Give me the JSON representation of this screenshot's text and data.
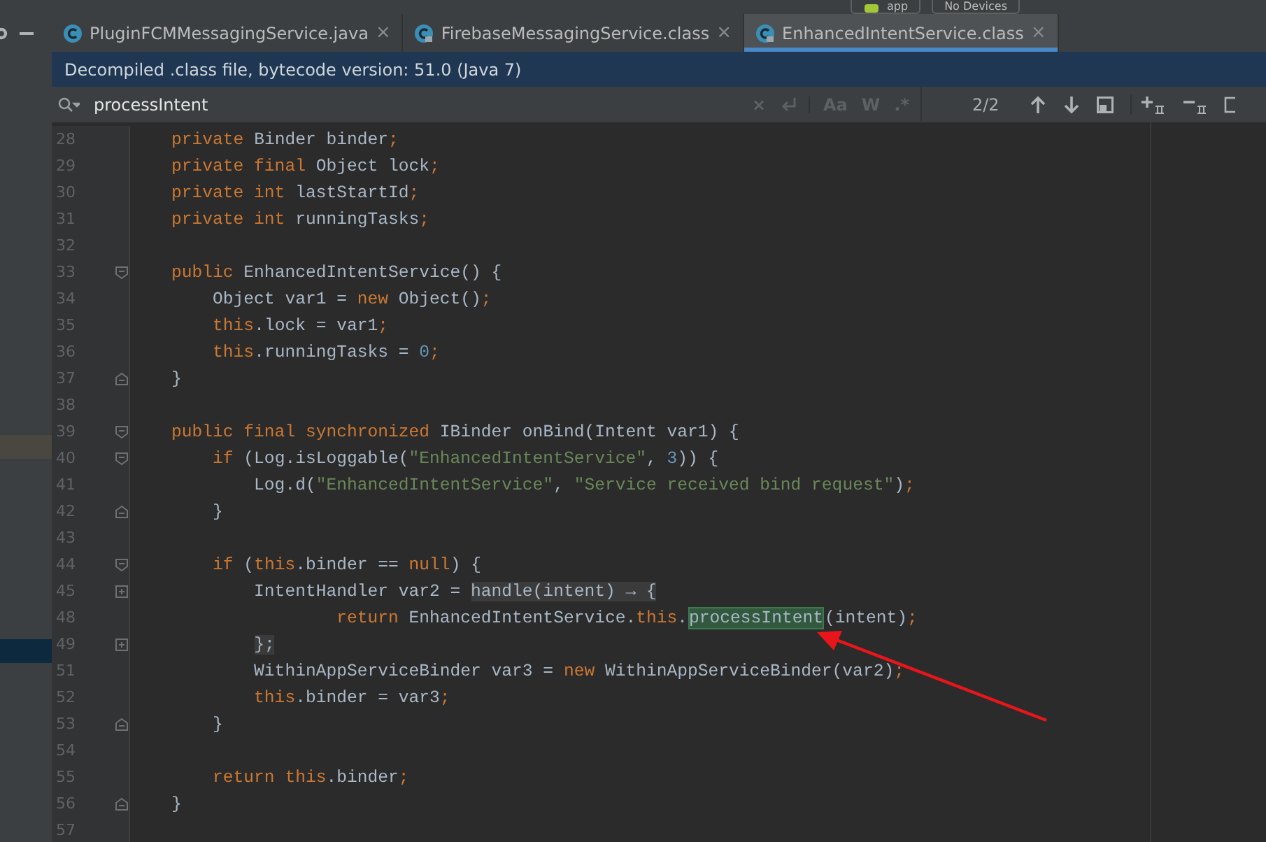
{
  "toolbar": {
    "configuration": "app",
    "device": "No Devices"
  },
  "tabs": [
    {
      "label": "PluginFCMMessagingService.java",
      "locked": false,
      "selected": false,
      "close": "×"
    },
    {
      "label": "FirebaseMessagingService.class",
      "locked": true,
      "selected": false,
      "close": "×"
    },
    {
      "label": "EnhancedIntentService.class",
      "locked": true,
      "selected": true,
      "close": "×"
    }
  ],
  "banner": "Decompiled .class file, bytecode version: 51.0 (Java 7)",
  "search": {
    "value": "processIntent",
    "clear": "×",
    "options": [
      "Aa",
      "W",
      ".*"
    ],
    "count": "2/2"
  },
  "lines": [
    {
      "number": "28",
      "tokens": [
        {
          "kind": "kw",
          "text": "    private"
        },
        {
          "kind": "plain",
          "text": " Binder binder"
        },
        {
          "kind": "kw",
          "text": ";"
        }
      ]
    },
    {
      "number": "29",
      "tokens": [
        {
          "kind": "kw",
          "text": "    private final"
        },
        {
          "kind": "plain",
          "text": " Object lock"
        },
        {
          "kind": "kw",
          "text": ";"
        }
      ]
    },
    {
      "number": "30",
      "tokens": [
        {
          "kind": "kw",
          "text": "    private int"
        },
        {
          "kind": "plain",
          "text": " lastStartId"
        },
        {
          "kind": "kw",
          "text": ";"
        }
      ]
    },
    {
      "number": "31",
      "tokens": [
        {
          "kind": "kw",
          "text": "    private int"
        },
        {
          "kind": "plain",
          "text": " runningTasks"
        },
        {
          "kind": "kw",
          "text": ";"
        }
      ]
    },
    {
      "number": "32"
    },
    {
      "number": "33",
      "kind": "foldstart",
      "tokens": [
        {
          "kind": "kw",
          "text": "    public"
        },
        {
          "kind": "plain",
          "text": " EnhancedIntentService() {"
        }
      ]
    },
    {
      "number": "34",
      "tokens": [
        {
          "kind": "plain",
          "text": "        Object var1 = "
        },
        {
          "kind": "kw",
          "text": "new"
        },
        {
          "kind": "plain",
          "text": " Object()"
        },
        {
          "kind": "kw",
          "text": ";"
        }
      ]
    },
    {
      "number": "35",
      "tokens": [
        {
          "kind": "kw",
          "text": "        this"
        },
        {
          "kind": "plain",
          "text": ".lock = var1"
        },
        {
          "kind": "kw",
          "text": ";"
        }
      ]
    },
    {
      "number": "36",
      "tokens": [
        {
          "kind": "kw",
          "text": "        this"
        },
        {
          "kind": "plain",
          "text": ".runningTasks = "
        },
        {
          "kind": "num",
          "text": "0"
        },
        {
          "kind": "kw",
          "text": ";"
        }
      ]
    },
    {
      "number": "37",
      "kind": "foldend",
      "tokens": [
        {
          "kind": "plain",
          "text": "    }"
        }
      ]
    },
    {
      "number": "38"
    },
    {
      "number": "39",
      "kind": "foldstart",
      "tokens": [
        {
          "kind": "kw",
          "text": "    public final synchronized"
        },
        {
          "kind": "plain",
          "text": " IBinder onBind(Intent var1) {"
        }
      ]
    },
    {
      "number": "40",
      "kind": "foldstart",
      "tokens": [
        {
          "kind": "kw",
          "text": "        if"
        },
        {
          "kind": "plain",
          "text": " (Log.isLoggable("
        },
        {
          "kind": "str",
          "text": "\"EnhancedIntentService\""
        },
        {
          "kind": "plain",
          "text": ", "
        },
        {
          "kind": "num",
          "text": "3"
        },
        {
          "kind": "plain",
          "text": ")) {"
        }
      ]
    },
    {
      "number": "41",
      "tokens": [
        {
          "kind": "plain",
          "text": "            Log.d("
        },
        {
          "kind": "str",
          "text": "\"EnhancedIntentService\""
        },
        {
          "kind": "plain",
          "text": ", "
        },
        {
          "kind": "str",
          "text": "\"Service received bind request\""
        },
        {
          "kind": "plain",
          "text": ")"
        },
        {
          "kind": "kw",
          "text": ";"
        }
      ]
    },
    {
      "number": "42",
      "kind": "foldend",
      "tokens": [
        {
          "kind": "plain",
          "text": "        }"
        }
      ]
    },
    {
      "number": "43"
    },
    {
      "number": "44",
      "kind": "foldstart",
      "tokens": [
        {
          "kind": "kw",
          "text": "        if"
        },
        {
          "kind": "plain",
          "text": " ("
        },
        {
          "kind": "kw",
          "text": "this"
        },
        {
          "kind": "plain",
          "text": ".binder == "
        },
        {
          "kind": "kw",
          "text": "null"
        },
        {
          "kind": "plain",
          "text": ") {"
        }
      ]
    },
    {
      "number": "45",
      "kind": "collapsed",
      "tokens": [
        {
          "kind": "plain",
          "text": "            IntentHandler var2 = "
        },
        {
          "kind": "folded",
          "text": "handle(intent) → {"
        }
      ]
    },
    {
      "number": "48",
      "tokens": [
        {
          "kind": "kw",
          "text": "                    return"
        },
        {
          "kind": "plain",
          "text": " EnhancedIntentService."
        },
        {
          "kind": "kw",
          "text": "this"
        },
        {
          "kind": "plain",
          "text": "."
        },
        {
          "kind": "match",
          "text": "processIntent"
        },
        {
          "kind": "plain",
          "text": "(intent)"
        },
        {
          "kind": "kw",
          "text": ";"
        }
      ]
    },
    {
      "number": "49",
      "kind": "collapsed",
      "tokens": [
        {
          "kind": "folded",
          "text": "            };"
        }
      ]
    },
    {
      "number": "51",
      "tokens": [
        {
          "kind": "plain",
          "text": "            WithinAppServiceBinder var3 = "
        },
        {
          "kind": "kw",
          "text": "new"
        },
        {
          "kind": "plain",
          "text": " WithinAppServiceBinder(var2)"
        },
        {
          "kind": "kw",
          "text": ";"
        }
      ]
    },
    {
      "number": "52",
      "tokens": [
        {
          "kind": "kw",
          "text": "            this"
        },
        {
          "kind": "plain",
          "text": ".binder = var3"
        },
        {
          "kind": "kw",
          "text": ";"
        }
      ]
    },
    {
      "number": "53",
      "kind": "foldend",
      "tokens": [
        {
          "kind": "plain",
          "text": "        }"
        }
      ]
    },
    {
      "number": "54"
    },
    {
      "number": "55",
      "tokens": [
        {
          "kind": "kw",
          "text": "        return this"
        },
        {
          "kind": "plain",
          "text": ".binder"
        },
        {
          "kind": "kw",
          "text": ";"
        }
      ]
    },
    {
      "number": "56",
      "kind": "foldend",
      "tokens": [
        {
          "kind": "plain",
          "text": "    }"
        }
      ]
    },
    {
      "number": "57"
    }
  ]
}
